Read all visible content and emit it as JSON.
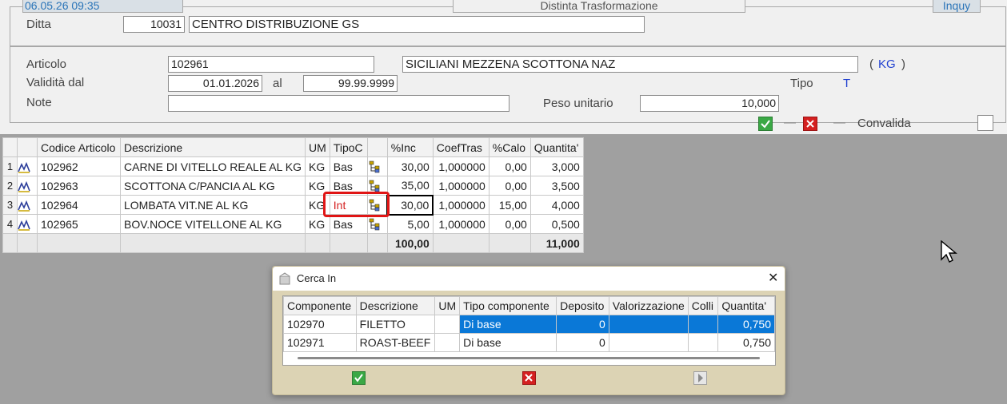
{
  "header": {
    "datetime": "06.05.26 09:35",
    "title": "Distinta Trasformazione",
    "mode": "Inquy"
  },
  "ditta": {
    "label": "Ditta",
    "code": "10031",
    "name": "CENTRO DISTRIBUZIONE GS"
  },
  "articolo": {
    "label": "Articolo",
    "code": "102961",
    "description": "SICILIANI MEZZENA SCOTTONA NAZ",
    "um_open": "(",
    "um": "KG",
    "um_close": ")"
  },
  "validita": {
    "label": "Validità dal",
    "from": "01.01.2026",
    "al_label": "al",
    "to": "99.99.9999"
  },
  "tipo": {
    "label": "Tipo",
    "value": "T"
  },
  "note": {
    "label": "Note",
    "value": ""
  },
  "peso": {
    "label": "Peso unitario",
    "value": "10,000"
  },
  "convalida": {
    "label": "Convalida",
    "dash": "—"
  },
  "grid": {
    "columns": [
      "Codice Articolo",
      "Descrizione",
      "UM",
      "TipoC",
      "",
      "%Inc",
      "CoefTras",
      "%Calo",
      "Quantita'"
    ],
    "rows": [
      {
        "n": "1",
        "code": "102962",
        "desc": "CARNE DI VITELLO REALE AL KG",
        "um": "KG",
        "tipo": "Bas",
        "inc": "30,00",
        "coef": "1,000000",
        "calo": "0,00",
        "qta": "3,000"
      },
      {
        "n": "2",
        "code": "102963",
        "desc": "SCOTTONA C/PANCIA  AL KG",
        "um": "KG",
        "tipo": "Bas",
        "inc": "35,00",
        "coef": "1,000000",
        "calo": "0,00",
        "qta": "3,500"
      },
      {
        "n": "3",
        "code": "102964",
        "desc": "LOMBATA VIT.NE AL KG",
        "um": "KG",
        "tipo": "Int",
        "inc": "30,00",
        "coef": "1,000000",
        "calo": "15,00",
        "qta": "4,000"
      },
      {
        "n": "4",
        "code": "102965",
        "desc": "BOV.NOCE VITELLONE AL KG",
        "um": "KG",
        "tipo": "Bas",
        "inc": "5,00",
        "coef": "1,000000",
        "calo": "0,00",
        "qta": "0,500"
      }
    ],
    "totals": {
      "inc": "100,00",
      "qta": "11,000"
    }
  },
  "dialog": {
    "title": "Cerca In",
    "close": "✕",
    "columns": [
      "Componente",
      "Descrizione",
      "UM",
      "Tipo componente",
      "Deposito",
      "Valorizzazione",
      "Colli",
      "Quantita'"
    ],
    "rows": [
      {
        "comp": "102970",
        "desc": "FILETTO",
        "um": "",
        "tipo": "Di base",
        "dep": "0",
        "val": "",
        "colli": "",
        "qta": "0,750"
      },
      {
        "comp": "102971",
        "desc": "ROAST-BEEF",
        "um": "",
        "tipo": "Di base",
        "dep": "0",
        "val": "",
        "colli": "",
        "qta": "0,750"
      }
    ]
  },
  "colors": {
    "accent": "#2a74b8",
    "selection": "#0a78d7",
    "highlight": "#e01515",
    "ok": "#3aa845",
    "cancel": "#d42020"
  }
}
